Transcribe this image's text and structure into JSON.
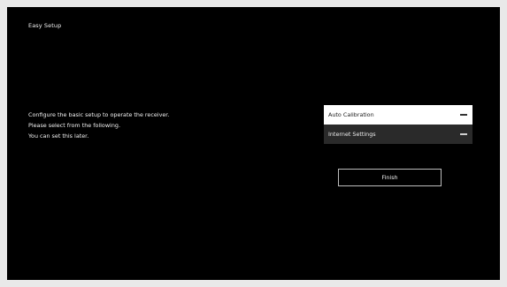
{
  "header": {
    "title": "Easy Setup"
  },
  "instructions": {
    "lines": [
      "Configure the basic setup to operate the receiver.",
      "Please select from the following.",
      "You can set this later."
    ]
  },
  "menu": {
    "items": [
      {
        "label": "Auto Calibration",
        "state": "selected",
        "icon": "dash-icon"
      },
      {
        "label": "Internet Settings",
        "state": "normal",
        "icon": "dash-icon"
      }
    ]
  },
  "actions": {
    "finish_label": "Finish"
  },
  "colors": {
    "background": "#000000",
    "selected_item": "#ffffff",
    "normal_item": "#2a2a2a",
    "button_border": "#bdbdbd"
  }
}
